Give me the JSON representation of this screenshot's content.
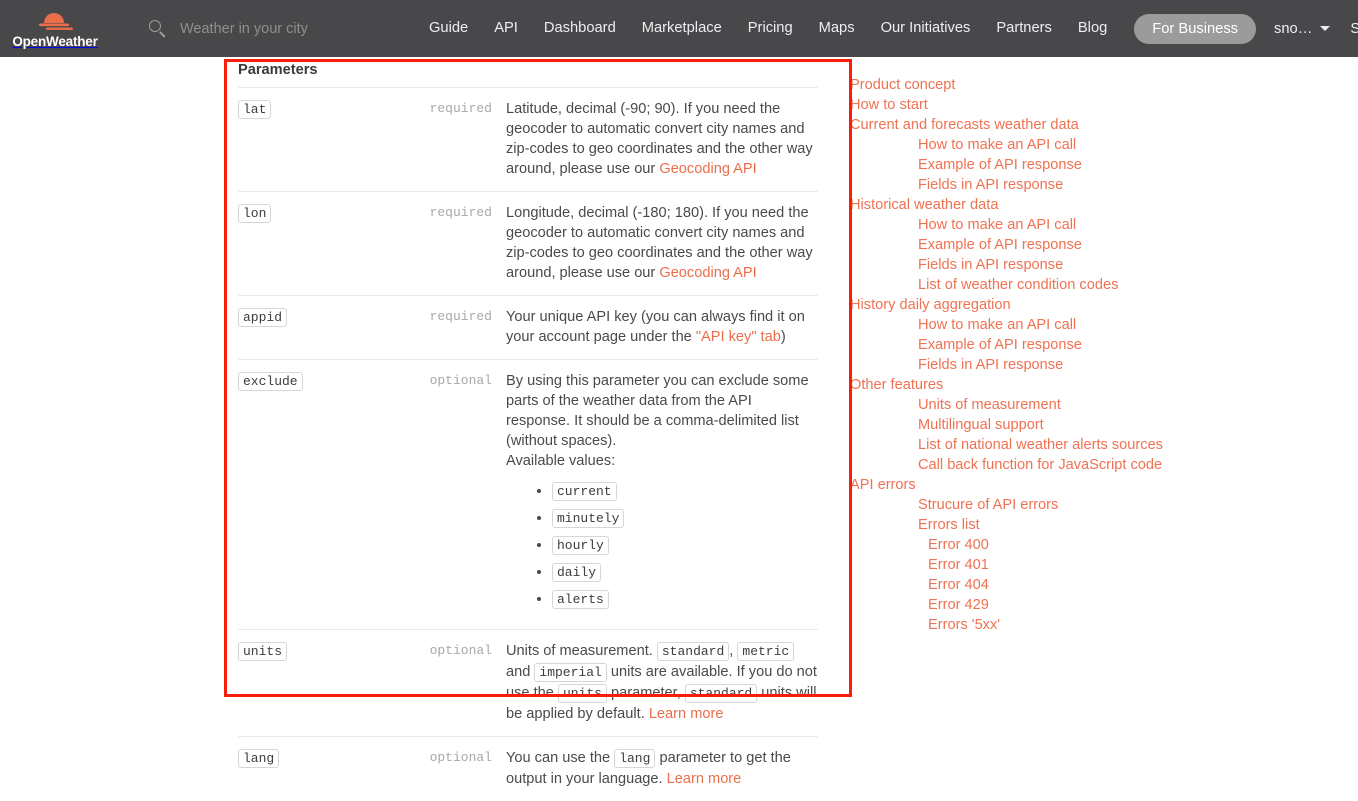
{
  "header": {
    "logo_text": "OpenWeather",
    "logo_icon": "sun-cloud-icon",
    "search": {
      "icon": "search-icon",
      "placeholder": "Weather in your city",
      "value": ""
    },
    "nav": [
      {
        "label": "Guide"
      },
      {
        "label": "API"
      },
      {
        "label": "Dashboard"
      },
      {
        "label": "Marketplace"
      },
      {
        "label": "Pricing"
      },
      {
        "label": "Maps"
      },
      {
        "label": "Our Initiatives"
      },
      {
        "label": "Partners"
      },
      {
        "label": "Blog"
      }
    ],
    "for_business_label": "For Business",
    "account_label": "sno…",
    "support_label": "Support",
    "caret_icon": "chevron-down-icon",
    "background_color": "#48484a",
    "accent_color": "#eb6e4b"
  },
  "annotation": {
    "color": "#f71e0c"
  },
  "parameters": {
    "title": "Parameters",
    "rows": [
      {
        "name": "lat",
        "requirement": "required",
        "desc_before_link": "Latitude, decimal (-90; 90). If you need the geocoder to automatic convert city names and zip-codes to geo coordinates and the other way around, please use our ",
        "link_text": "Geocoding API",
        "desc_after_link": ""
      },
      {
        "name": "lon",
        "requirement": "required",
        "desc_before_link": "Longitude, decimal (-180; 180). If you need the geocoder to automatic convert city names and zip-codes to geo coordinates and the other way around, please use our ",
        "link_text": "Geocoding API",
        "desc_after_link": ""
      },
      {
        "name": "appid",
        "requirement": "required",
        "desc_before_link": "Your unique API key (you can always find it on your account page under the ",
        "link_text": "\"API key\" tab",
        "desc_after_link": ")"
      },
      {
        "name": "exclude",
        "requirement": "optional",
        "desc_line1": "By using this parameter you can exclude some parts of the weather data from the API response. It should be a comma-delimited list (without spaces).",
        "desc_line2": "Available values:",
        "values": [
          "current",
          "minutely",
          "hourly",
          "daily",
          "alerts"
        ]
      },
      {
        "name": "units",
        "requirement": "optional",
        "seg1": "Units of measurement. ",
        "code1": "standard",
        "seg2": ", ",
        "code2": "metric",
        "seg3": " and ",
        "code3": "imperial",
        "seg4": " units are available. If you do not use the ",
        "code4": "units",
        "seg5": " parameter, ",
        "code5": "standard",
        "seg6": " units will be applied by default. ",
        "link_text": "Learn more"
      },
      {
        "name": "lang",
        "requirement": "optional",
        "seg1": "You can use the ",
        "code1": "lang",
        "seg2": " parameter to get the output in your language. ",
        "link_text": "Learn more"
      }
    ]
  },
  "toc": {
    "items": [
      {
        "label": "Product concept",
        "level": 0
      },
      {
        "label": "How to start",
        "level": 0
      },
      {
        "label": "Current and forecasts weather data",
        "level": 0
      },
      {
        "label": "How to make an API call",
        "level": 1
      },
      {
        "label": "Example of API response",
        "level": 1
      },
      {
        "label": "Fields in API response",
        "level": 1
      },
      {
        "label": "Historical weather data",
        "level": 0
      },
      {
        "label": "How to make an API call",
        "level": 1
      },
      {
        "label": "Example of API response",
        "level": 1
      },
      {
        "label": "Fields in API response",
        "level": 1
      },
      {
        "label": "List of weather condition codes",
        "level": 1
      },
      {
        "label": "History daily aggregation",
        "level": 0
      },
      {
        "label": "How to make an API call",
        "level": 1
      },
      {
        "label": "Example of API response",
        "level": 1
      },
      {
        "label": "Fields in API response",
        "level": 1
      },
      {
        "label": "Other features",
        "level": 0
      },
      {
        "label": "Units of measurement",
        "level": 1
      },
      {
        "label": "Multilingual support",
        "level": 1
      },
      {
        "label": "List of national weather alerts sources",
        "level": 1
      },
      {
        "label": "Call back function for JavaScript code",
        "level": 1
      },
      {
        "label": "API errors",
        "level": 0
      },
      {
        "label": "Strucure of API errors",
        "level": 1
      },
      {
        "label": "Errors list",
        "level": 1
      },
      {
        "label": "Error 400",
        "level": 2
      },
      {
        "label": "Error 401",
        "level": 2
      },
      {
        "label": "Error 404",
        "level": 2
      },
      {
        "label": "Error 429",
        "level": 2
      },
      {
        "label": "Errors '5xx'",
        "level": 2
      }
    ]
  }
}
